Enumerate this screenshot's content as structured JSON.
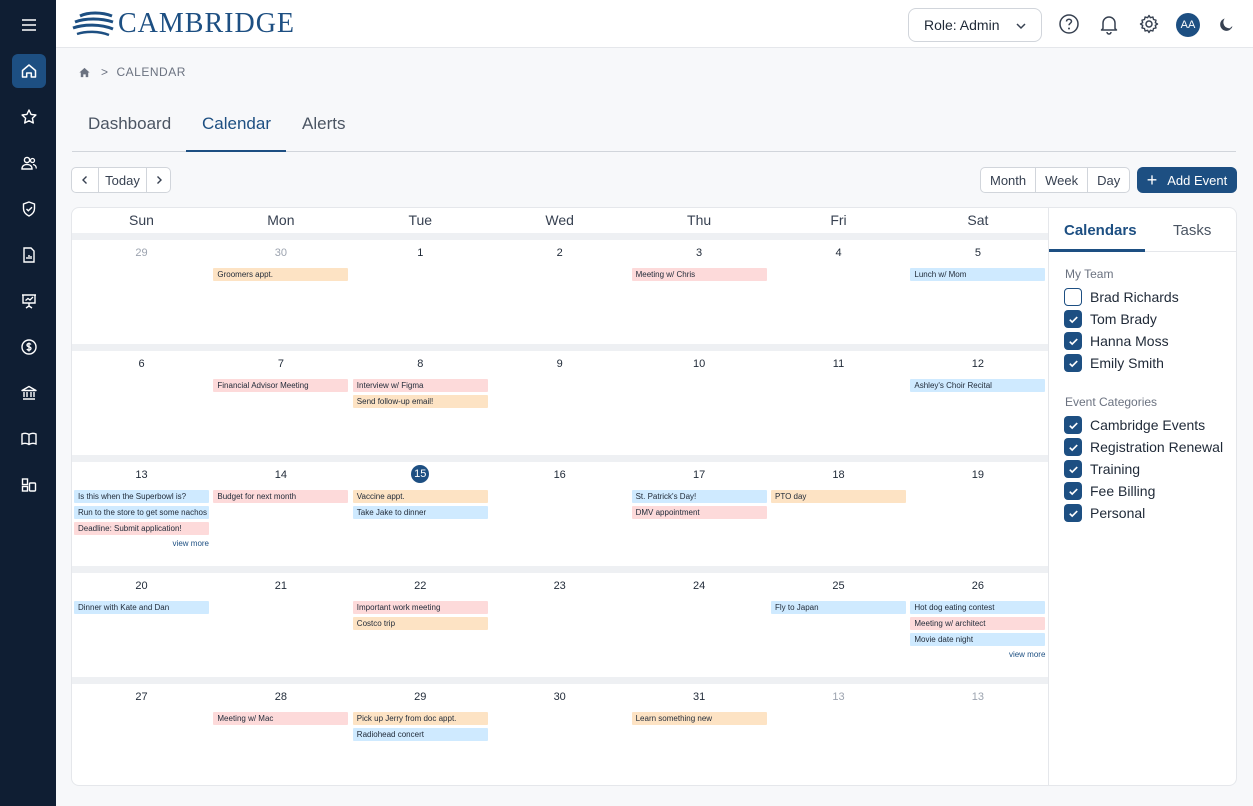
{
  "brand": {
    "name": "CAMBRIDGE",
    "color": "#1d4f82"
  },
  "header": {
    "role_label": "Role: Admin"
  },
  "avatar": {
    "initials": "AA"
  },
  "breadcrumb": {
    "current": "CALENDAR"
  },
  "tabs": [
    {
      "label": "Dashboard"
    },
    {
      "label": "Calendar",
      "active": true
    },
    {
      "label": "Alerts"
    }
  ],
  "toolbar": {
    "today_label": "Today",
    "views": [
      "Month",
      "Week",
      "Day"
    ],
    "add_event_label": "Add Event"
  },
  "calendar": {
    "weekdays": [
      "Sun",
      "Mon",
      "Tue",
      "Wed",
      "Thu",
      "Fri",
      "Sat"
    ],
    "today": 15,
    "weeks": [
      {
        "days": [
          {
            "num": "29",
            "muted": true,
            "events": []
          },
          {
            "num": "30",
            "muted": true,
            "events": [
              {
                "label": "Groomers appt.",
                "color": "orange"
              }
            ]
          },
          {
            "num": "1",
            "events": []
          },
          {
            "num": "2",
            "events": []
          },
          {
            "num": "3",
            "events": [
              {
                "label": "Meeting w/ Chris",
                "color": "pink"
              }
            ]
          },
          {
            "num": "4",
            "events": []
          },
          {
            "num": "5",
            "events": [
              {
                "label": "Lunch w/ Mom",
                "color": "blue"
              }
            ]
          }
        ]
      },
      {
        "days": [
          {
            "num": "6",
            "events": []
          },
          {
            "num": "7",
            "events": [
              {
                "label": "Financial Advisor Meeting",
                "color": "pink"
              }
            ]
          },
          {
            "num": "8",
            "events": [
              {
                "label": "Interview w/ Figma",
                "color": "pink"
              },
              {
                "label": "Send follow-up email!",
                "color": "orange"
              }
            ]
          },
          {
            "num": "9",
            "events": []
          },
          {
            "num": "10",
            "events": []
          },
          {
            "num": "11",
            "events": []
          },
          {
            "num": "12",
            "events": [
              {
                "label": "Ashley's Choir Recital",
                "color": "blue"
              }
            ]
          }
        ]
      },
      {
        "days": [
          {
            "num": "13",
            "events": [
              {
                "label": "Is this when the Superbowl is?",
                "color": "blue"
              },
              {
                "label": "Run to the store to get some nachos",
                "color": "blue"
              },
              {
                "label": "Deadline: Submit application!",
                "color": "pink"
              }
            ],
            "view_more": "view more"
          },
          {
            "num": "14",
            "events": [
              {
                "label": "Budget for next month",
                "color": "pink"
              }
            ]
          },
          {
            "num": "15",
            "today": true,
            "events": [
              {
                "label": "Vaccine appt.",
                "color": "orange"
              },
              {
                "label": "Take Jake to dinner",
                "color": "blue"
              }
            ]
          },
          {
            "num": "16",
            "events": []
          },
          {
            "num": "17",
            "events": [
              {
                "label": "St. Patrick's Day!",
                "color": "blue"
              },
              {
                "label": "DMV appointment",
                "color": "pink"
              }
            ]
          },
          {
            "num": "18",
            "events": [
              {
                "label": "PTO day",
                "color": "orange"
              }
            ]
          },
          {
            "num": "19",
            "events": []
          }
        ]
      },
      {
        "days": [
          {
            "num": "20",
            "events": [
              {
                "label": "Dinner with Kate and Dan",
                "color": "blue"
              }
            ]
          },
          {
            "num": "21",
            "events": []
          },
          {
            "num": "22",
            "events": [
              {
                "label": "Important work meeting",
                "color": "pink"
              },
              {
                "label": "Costco trip",
                "color": "orange"
              }
            ]
          },
          {
            "num": "23",
            "events": []
          },
          {
            "num": "24",
            "events": []
          },
          {
            "num": "25",
            "events": [
              {
                "label": "Fly to Japan",
                "color": "blue"
              }
            ]
          },
          {
            "num": "26",
            "events": [
              {
                "label": "Hot dog eating contest",
                "color": "blue"
              },
              {
                "label": "Meeting w/ architect",
                "color": "pink"
              },
              {
                "label": "Movie date night",
                "color": "blue"
              }
            ],
            "view_more": "view more"
          }
        ]
      },
      {
        "days": [
          {
            "num": "27",
            "events": []
          },
          {
            "num": "28",
            "events": [
              {
                "label": "Meeting w/ Mac",
                "color": "pink"
              }
            ]
          },
          {
            "num": "29",
            "events": [
              {
                "label": "Pick up Jerry from doc appt.",
                "color": "orange"
              },
              {
                "label": "Radiohead concert",
                "color": "blue"
              }
            ]
          },
          {
            "num": "30",
            "events": []
          },
          {
            "num": "31",
            "events": [
              {
                "label": "Learn something new",
                "color": "orange"
              }
            ]
          },
          {
            "num": "13",
            "muted": true,
            "events": []
          },
          {
            "num": "13",
            "muted": true,
            "events": []
          }
        ]
      }
    ]
  },
  "side_panel": {
    "tabs": [
      "Calendars",
      "Tasks"
    ],
    "team_label": "My Team",
    "team": [
      {
        "name": "Brad Richards",
        "checked": false
      },
      {
        "name": "Tom Brady",
        "checked": true
      },
      {
        "name": "Hanna Moss",
        "checked": true
      },
      {
        "name": "Emily Smith",
        "checked": true
      }
    ],
    "categories_label": "Event Categories",
    "categories": [
      {
        "name": "Cambridge Events",
        "checked": true
      },
      {
        "name": "Registration Renewal",
        "checked": true
      },
      {
        "name": "Training",
        "checked": true
      },
      {
        "name": "Fee Billing",
        "checked": true
      },
      {
        "name": "Personal",
        "checked": true
      }
    ]
  },
  "colors": {
    "accent": "#1d4f82",
    "rail": "#0f1e33",
    "event_blue": "#cfeaff",
    "event_pink": "#fddada",
    "event_orange": "#fde3c4"
  }
}
